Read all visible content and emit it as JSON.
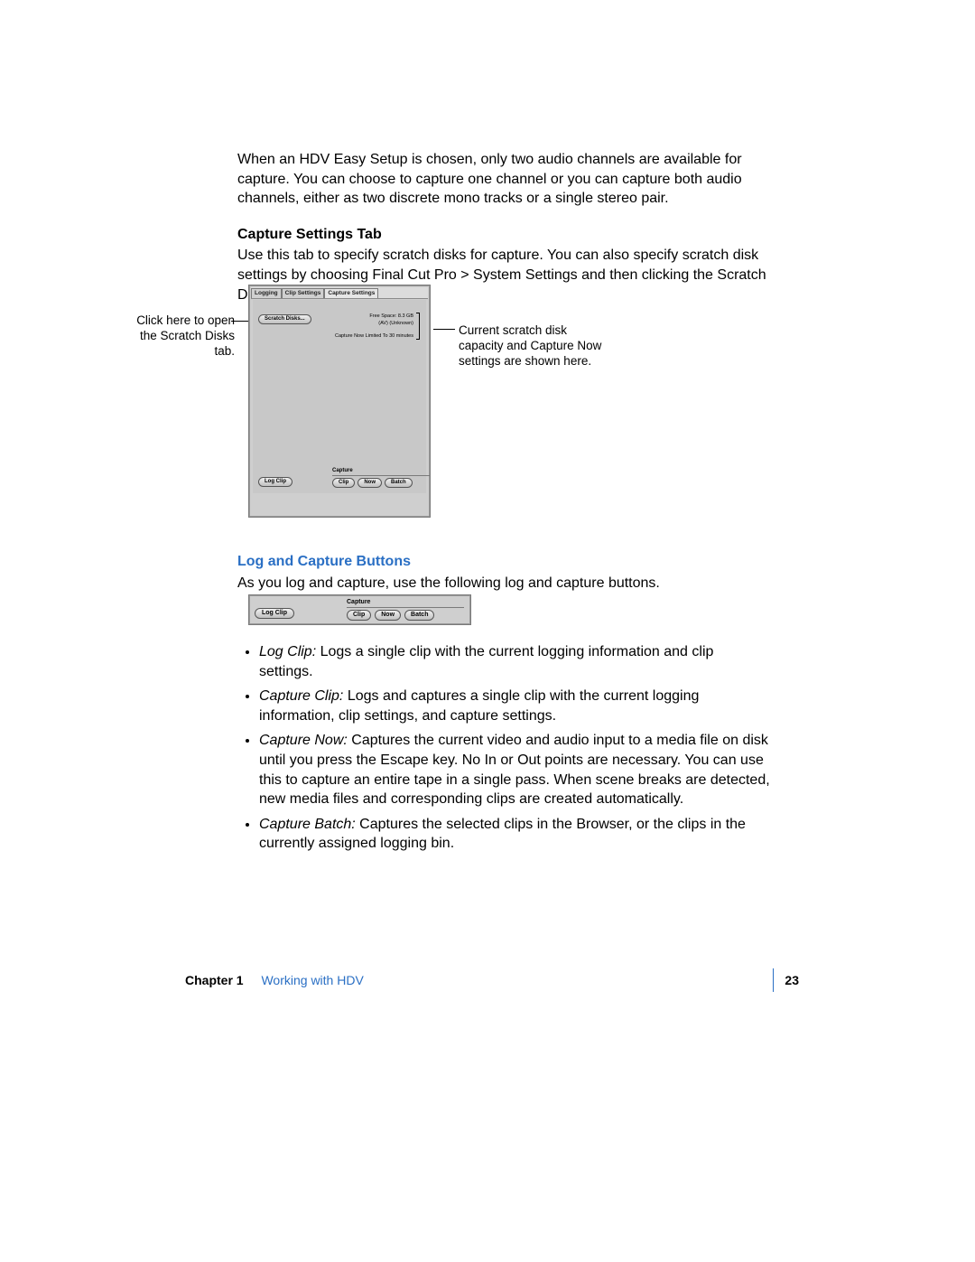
{
  "intro_para": "When an HDV Easy Setup is chosen, only two audio channels are available for capture. You can choose to capture one channel or you can capture both audio channels, either as two discrete mono tracks or a single stereo pair.",
  "sec1": {
    "heading": "Capture Settings Tab",
    "body": "Use this tab to specify scratch disks for capture. You can also specify scratch disk settings by choosing Final Cut Pro > System Settings and then clicking the Scratch Disks tab."
  },
  "callouts": {
    "left": "Click here to open the Scratch Disks tab.",
    "right": "Current scratch disk capacity and Capture Now settings are shown here."
  },
  "panel": {
    "tabs": [
      "Logging",
      "Clip Settings",
      "Capture Settings"
    ],
    "scratch_button": "Scratch Disks...",
    "info1": "Free Space: 8.3 GB",
    "info2": "(AV) (Unknown)",
    "info3": "Capture Now Limited To 30 minutes",
    "capture_label": "Capture",
    "log_clip": "Log Clip",
    "clip": "Clip",
    "now": "Now",
    "batch": "Batch"
  },
  "sec2": {
    "heading": "Log and Capture Buttons",
    "intro": "As you log and capture, use the following log and capture buttons."
  },
  "bar": {
    "log_clip": "Log Clip",
    "capture_label": "Capture",
    "clip": "Clip",
    "now": "Now",
    "batch": "Batch"
  },
  "bullets": [
    {
      "label": "Log Clip:",
      "text": " Logs a single clip with the current logging information and clip settings."
    },
    {
      "label": "Capture Clip:",
      "text": " Logs and captures a single clip with the current logging information, clip settings, and capture settings."
    },
    {
      "label": "Capture Now:",
      "text": " Captures the current video and audio input to a media file on disk until you press the Escape key. No In or Out points are necessary. You can use this to capture an entire tape in a single pass. When scene breaks are detected, new media files and corresponding clips are created automatically."
    },
    {
      "label": "Capture Batch:",
      "text": " Captures the selected clips in the Browser, or the clips in the currently assigned logging bin."
    }
  ],
  "footer": {
    "chapter": "Chapter 1",
    "title": "Working with HDV",
    "page": "23"
  }
}
